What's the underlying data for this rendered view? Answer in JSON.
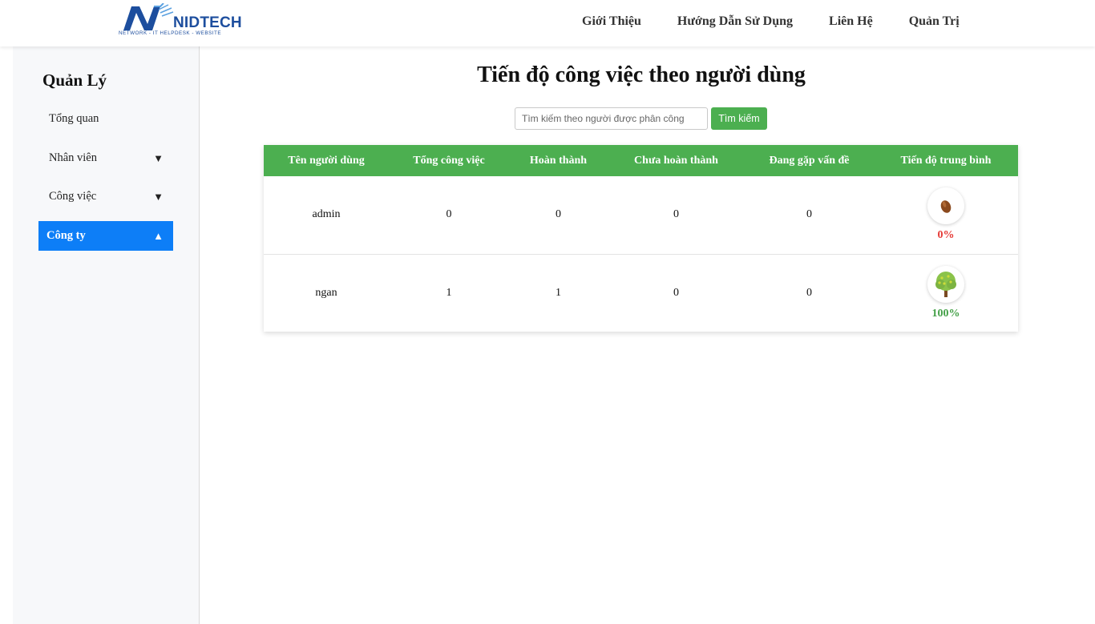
{
  "header": {
    "logo_word": "NIDTECH",
    "logo_tagline": "NETWORK - IT HELPDESK - WEBSITE",
    "nav": [
      "Giới Thiệu",
      "Hướng Dẫn Sử Dụng",
      "Liên Hệ",
      "Quản Trị"
    ]
  },
  "sidebar": {
    "title": "Quản Lý",
    "items": [
      {
        "label": "Tổng quan",
        "arrow": ""
      },
      {
        "label": "Nhân viên",
        "arrow": "▼"
      },
      {
        "label": "Công việc",
        "arrow": "▼"
      },
      {
        "label": "Công ty",
        "arrow": "▲",
        "active": true
      }
    ]
  },
  "main": {
    "title": "Tiến độ công việc theo người dùng",
    "search": {
      "placeholder": "Tìm kiếm theo người được phân công",
      "button": "Tìm kiếm"
    },
    "table": {
      "headers": [
        "Tên người dùng",
        "Tổng công việc",
        "Hoàn thành",
        "Chưa hoàn thành",
        "Đang gặp vấn đề",
        "Tiến độ trung bình"
      ],
      "rows": [
        {
          "user": "admin",
          "total": "0",
          "done": "0",
          "not_done": "0",
          "issues": "0",
          "progress": "0%",
          "progress_icon": "seed-icon",
          "progress_color": "#e53935"
        },
        {
          "user": "ngan",
          "total": "1",
          "done": "1",
          "not_done": "0",
          "issues": "0",
          "progress": "100%",
          "progress_icon": "tree-icon",
          "progress_color": "#43a047"
        }
      ]
    }
  },
  "colors": {
    "accent_green": "#4caf50",
    "active_blue": "#0d7ef7",
    "brand_blue": "#1d4e9e"
  }
}
